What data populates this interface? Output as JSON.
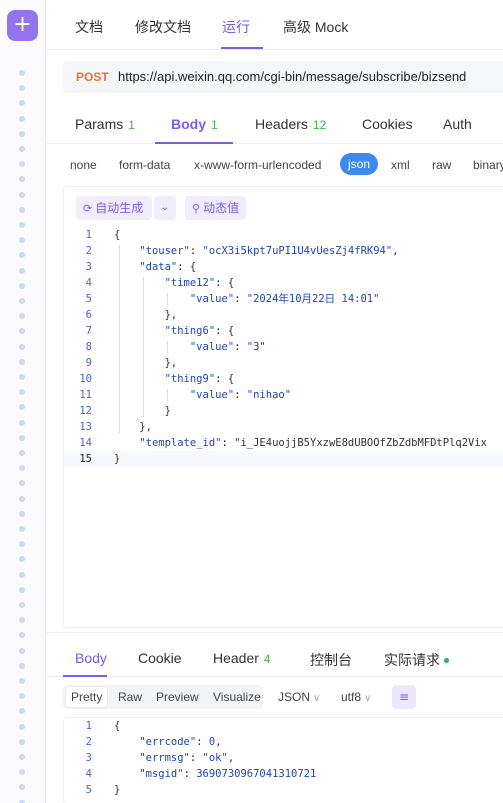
{
  "rail": {
    "add_symbol": "+",
    "dots": 49
  },
  "top_tabs": [
    {
      "label": "文档"
    },
    {
      "label": "修改文档"
    },
    {
      "label": "运行",
      "active": true
    },
    {
      "label": "高级 Mock"
    }
  ],
  "request": {
    "method": "POST",
    "url": "https://api.weixin.qq.com/cgi-bin/message/subscribe/bizsend"
  },
  "request_tabs": [
    {
      "label": "Params",
      "count": "1"
    },
    {
      "label": "Body",
      "count": "1",
      "active": true
    },
    {
      "label": "Headers",
      "count": "12"
    },
    {
      "label": "Cookies",
      "count": ""
    },
    {
      "label": "Auth",
      "count": ""
    }
  ],
  "body_types": [
    {
      "label": "none"
    },
    {
      "label": "form-data"
    },
    {
      "label": "x-www-form-urlencoded"
    },
    {
      "label": "json",
      "active": true
    },
    {
      "label": "xml"
    },
    {
      "label": "raw"
    },
    {
      "label": "binary"
    }
  ],
  "editor_toolbar": {
    "auto_generate": "自动生成",
    "dynamic_value": "动态值"
  },
  "body_code": [
    "{",
    "    \"touser\": \"ocX3i5kpt7uPI1U4vUesZj4fRK94\",",
    "    \"data\": {",
    "        \"time12\": {",
    "            \"value\": \"2024年10月22日 14:01\"",
    "        },",
    "        \"thing6\": {",
    "            \"value\": \"3\"",
    "        },",
    "        \"thing9\": {",
    "            \"value\": \"nihao\"",
    "        }",
    "    },",
    "    \"template_id\": \"i_JE4uojjB5YxzwE8dUBOOfZbZdbMFDtPlq2Vix",
    "}"
  ],
  "body_current_line": 15,
  "response_tabs": [
    {
      "label": "Body",
      "count": "",
      "active": true
    },
    {
      "label": "Cookie",
      "count": ""
    },
    {
      "label": "Header",
      "count": "4"
    },
    {
      "label": "控制台",
      "count": ""
    },
    {
      "label": "实际请求",
      "count": "",
      "dot": true
    }
  ],
  "view_modes": [
    {
      "label": "Pretty",
      "active": true
    },
    {
      "label": "Raw"
    },
    {
      "label": "Preview"
    },
    {
      "label": "Visualize"
    }
  ],
  "format_select": "JSON",
  "encoding_select": "utf8",
  "response_code": [
    "{",
    "    \"errcode\": 0,",
    "    \"errmsg\": \"ok\",",
    "    \"msgid\": 3690730967041310721",
    "}"
  ],
  "colors": {
    "accent": "#7a5cf0",
    "method": "#e8743b",
    "count": "#4caf50",
    "json_selected": "#3c8af0"
  }
}
